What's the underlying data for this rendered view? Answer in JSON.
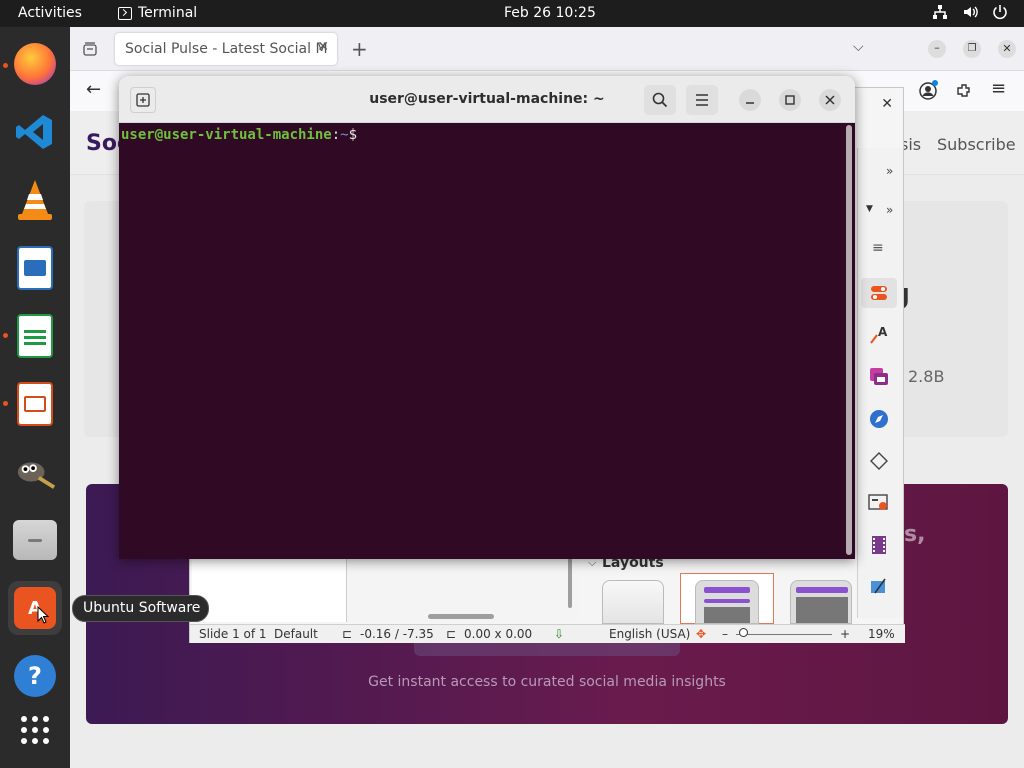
{
  "topbar": {
    "activities": "Activities",
    "app_name": "Terminal",
    "clock": "Feb 26  10:25"
  },
  "dock": {
    "items": [
      "Firefox",
      "Visual Studio Code",
      "VLC",
      "LibreOffice Writer",
      "LibreOffice Calc",
      "LibreOffice Impress",
      "GIMP",
      "Files",
      "Ubuntu Software",
      "Help",
      "Show Applications"
    ],
    "tooltip": "Ubuntu Software"
  },
  "browser": {
    "tab_title": "Social Pulse - Latest Social M",
    "site_logo_partial": "Soc",
    "nav_partial": "sis",
    "subscribe": "Subscribe",
    "card_partial_heading": "g",
    "card_stat": "2.8B",
    "banner_partial": "s,",
    "banner_caption": "Get instant access to curated social media insights"
  },
  "impress": {
    "layouts_label": "Layouts",
    "status": {
      "slide": "Slide 1 of 1",
      "master": "Default",
      "position": "-0.16 / -7.35",
      "size": "0.00 x 0.00",
      "language": "English (USA)",
      "zoom": "19%"
    }
  },
  "terminal": {
    "title": "user@user-virtual-machine: ~",
    "prompt_user": "user@user-virtual-machine",
    "prompt_sep": ":",
    "prompt_path": "~",
    "prompt_symbol": "$"
  },
  "colors": {
    "terminal_bg": "#300a24",
    "prompt_user": "#6fc13a",
    "prompt_path": "#6f8fd4",
    "ubuntu_orange": "#e95420"
  }
}
